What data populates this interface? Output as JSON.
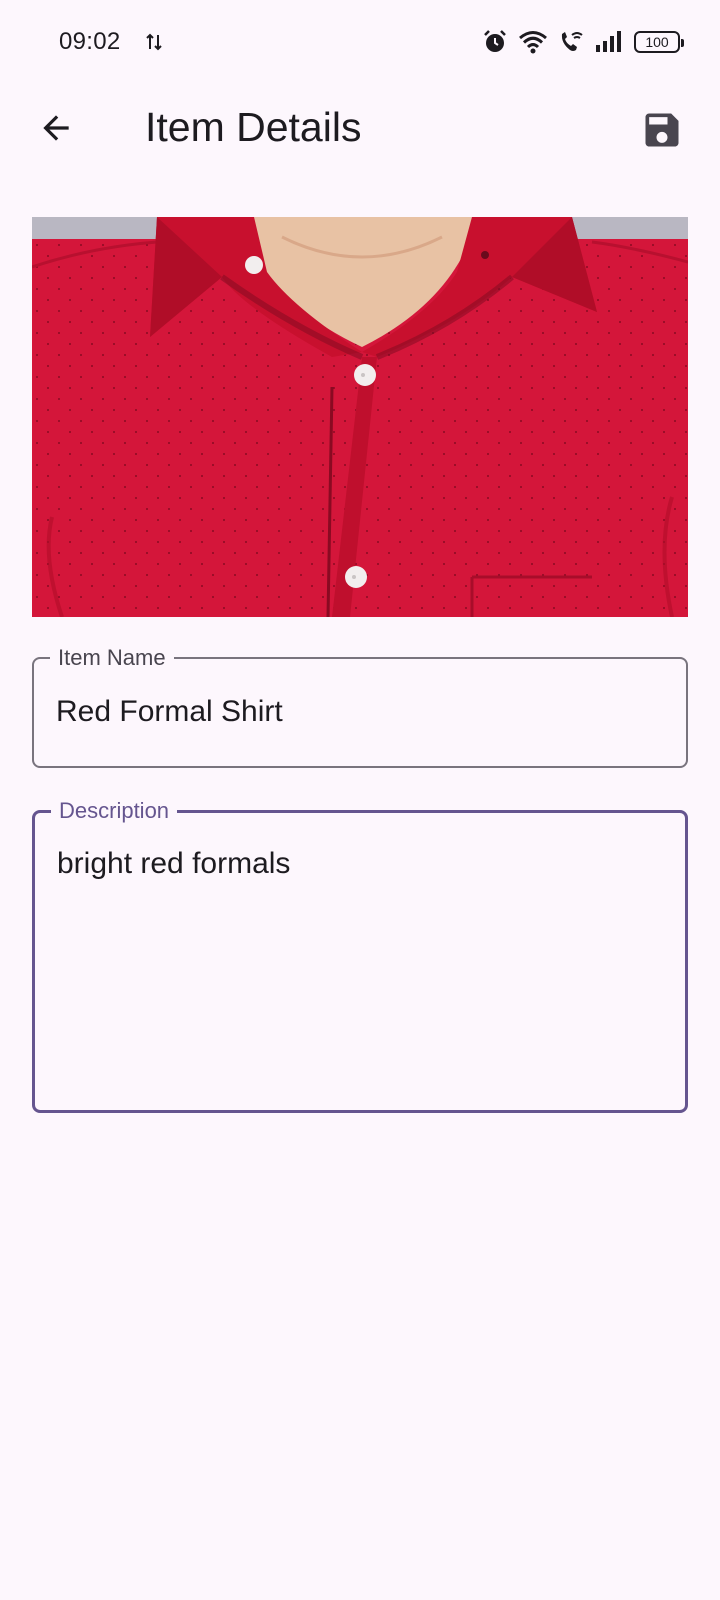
{
  "status_bar": {
    "time": "09:02",
    "battery": "100",
    "icons": [
      "data-transfer-icon",
      "alarm-icon",
      "wifi-icon",
      "wifi-call-icon",
      "signal-icon",
      "battery-icon"
    ]
  },
  "app_bar": {
    "title": "Item Details",
    "back_icon": "arrow-back-icon",
    "save_icon": "save-icon"
  },
  "item": {
    "image_subject": "red-formal-shirt-photo",
    "fields": {
      "name": {
        "label": "Item Name",
        "value": "Red Formal Shirt"
      },
      "description": {
        "label": "Description",
        "value": "bright red formals"
      }
    }
  },
  "colors": {
    "background": "#fdf7fd",
    "text": "#1d1b20",
    "focused_accent": "#65558f",
    "outline": "#79747e",
    "shirt_red": "#d4163a"
  }
}
